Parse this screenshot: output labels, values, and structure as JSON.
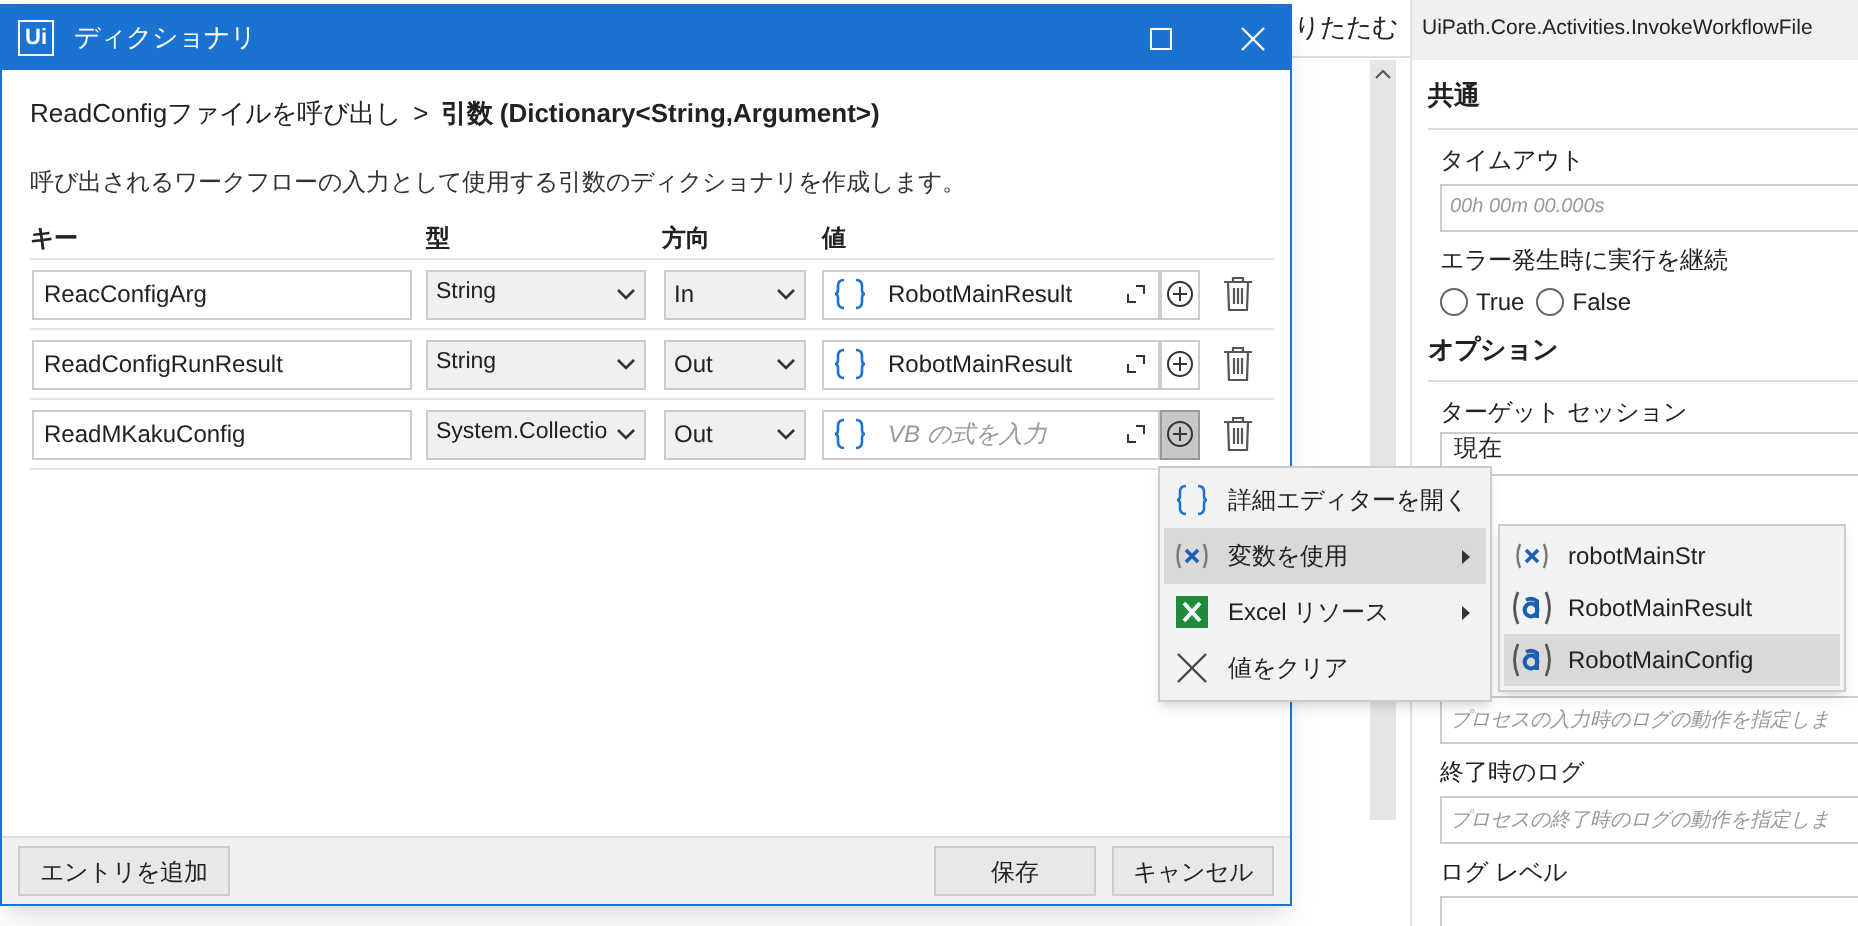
{
  "background": {
    "collapse_label": "りたたむ"
  },
  "properties": {
    "header": "UiPath.Core.Activities.InvokeWorkflowFile",
    "sections": [
      {
        "title": "共通",
        "fields": [
          {
            "kind": "input",
            "label": "タイムアウト",
            "placeholder": "00h 00m 00.000s"
          },
          {
            "kind": "radio",
            "label": "エラー発生時に実行を継続",
            "options": [
              {
                "label": "True",
                "selected": false
              },
              {
                "label": "False",
                "selected": false
              }
            ]
          }
        ]
      },
      {
        "title": "オプション",
        "fields": [
          {
            "kind": "select",
            "label": "ターゲット セッション",
            "value": "現在"
          },
          {
            "kind": "input",
            "placeholder": "プロセスの入力時のログの動作を指定しま"
          },
          {
            "kind": "input",
            "label": "終了時のログ",
            "placeholder": "プロセスの終了時のログの動作を指定しま"
          },
          {
            "kind": "input",
            "label": "ログ レベル"
          }
        ]
      }
    ]
  },
  "dialog": {
    "logo": "Ui",
    "title": "ディクショナリ",
    "breadcrumb": {
      "path": "ReadConfigファイルを呼び出し",
      "separator": ">",
      "current": "引数 (Dictionary<String,Argument>)"
    },
    "description": "呼び出されるワークフローの入力として使用する引数のディクショナリを作成します。",
    "columns": [
      "キー",
      "型",
      "方向",
      "値"
    ],
    "rows": [
      {
        "key": "ReacConfigArg",
        "type": "String",
        "direction": "In",
        "value": "RobotMainResult",
        "menu_open": false
      },
      {
        "key": "ReadConfigRunResult",
        "type": "String",
        "direction": "Out",
        "value": "RobotMainResult",
        "menu_open": false
      },
      {
        "key": "ReadMKakuConfig",
        "type": "System.Collectio",
        "direction": "Out",
        "placeholder": "VB の式を入力",
        "menu_open": true
      }
    ],
    "footer_buttons": [
      {
        "label": "エントリを追加"
      },
      {
        "label": "保存"
      },
      {
        "label": "キャンセル"
      }
    ]
  },
  "context_menu": {
    "items": [
      {
        "kind": "editor",
        "label": "詳細エディターを開く",
        "selected": false,
        "has_submenu": false
      },
      {
        "kind": "variable",
        "label": "変数を使用",
        "selected": true,
        "has_submenu": true
      },
      {
        "kind": "excel",
        "label": "Excel リソース",
        "selected": false,
        "has_submenu": true
      },
      {
        "kind": "clear",
        "label": "値をクリア",
        "selected": false,
        "has_submenu": false
      }
    ]
  },
  "submenu": {
    "items": [
      {
        "kind": "variable",
        "label": "robotMainStr",
        "selected": false
      },
      {
        "kind": "argument",
        "label": "RobotMainResult",
        "selected": false
      },
      {
        "kind": "argument",
        "label": "RobotMainConfig",
        "selected": true
      }
    ]
  }
}
